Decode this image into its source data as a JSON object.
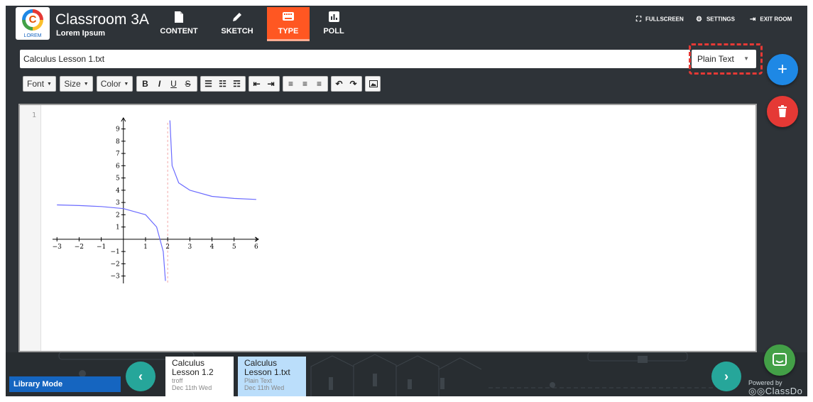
{
  "app": {
    "room_title": "Classroom 3A",
    "room_subtitle": "Lorem Ipsum",
    "logo_text": "LOREM"
  },
  "tabs": [
    {
      "label": "CONTENT",
      "icon": "file-icon",
      "active": false
    },
    {
      "label": "SKETCH",
      "icon": "pencil-icon",
      "active": false
    },
    {
      "label": "TYPE",
      "icon": "keyboard-icon",
      "active": true
    },
    {
      "label": "POLL",
      "icon": "poll-chart-icon",
      "active": false
    }
  ],
  "top_links": {
    "fullscreen": "FULLSCREEN",
    "settings": "SETTINGS",
    "exit": "EXIT ROOM"
  },
  "document": {
    "filename": "Calculus Lesson 1.txt",
    "format": "Plain Text"
  },
  "toolbar": {
    "font": "Font",
    "size": "Size",
    "color": "Color",
    "buttons": [
      "bold",
      "italic",
      "underline",
      "strikethrough",
      "bullet-list",
      "numbered-list",
      "checklist",
      "outdent",
      "indent",
      "align-left",
      "align-center",
      "align-right",
      "undo",
      "redo",
      "insert-image"
    ]
  },
  "editor": {
    "line_number": "1"
  },
  "chart_data": {
    "type": "line",
    "title": "",
    "xlabel": "",
    "ylabel": "",
    "xlim": [
      -3.2,
      6.1
    ],
    "ylim": [
      -3.6,
      9.9
    ],
    "x_ticks": [
      "−3",
      "−2",
      "−1",
      "1",
      "2",
      "3",
      "4",
      "5",
      "6"
    ],
    "y_ticks": [
      "9",
      "8",
      "7",
      "6",
      "5",
      "4",
      "3",
      "2",
      "1",
      "−1",
      "−2",
      "−3"
    ],
    "asymptote_x": 2,
    "series": [
      {
        "x": [
          -3,
          -2,
          -1,
          0,
          1,
          1.5,
          1.8,
          1.9
        ],
        "y": [
          2.8,
          2.75,
          2.67,
          2.5,
          2.0,
          1.0,
          -1.0,
          -3.4
        ]
      },
      {
        "x": [
          2.1,
          2.2,
          2.5,
          3,
          4,
          5,
          6
        ],
        "y": [
          9.7,
          6.0,
          4.6,
          4.0,
          3.5,
          3.33,
          3.25
        ]
      }
    ],
    "line_color": "#6b6bff"
  },
  "footer": {
    "library_mode": "Library Mode",
    "cards": [
      {
        "name": "Calculus Lesson 1.2",
        "type": "troff",
        "date": "Dec 11th Wed"
      },
      {
        "name": "Calculus Lesson 1.txt",
        "type": "Plain Text",
        "date": "Dec 11th Wed"
      }
    ],
    "powered_by": "Powered by",
    "brand": "ClassDo"
  },
  "colors": {
    "topbar": "#2e3338",
    "active_tab": "#ff5722",
    "add_fab": "#1e88e5",
    "delete_fab": "#e53935",
    "chat_fab": "#43a047",
    "nav": "#26a69a",
    "highlight_box": "#e53935"
  }
}
